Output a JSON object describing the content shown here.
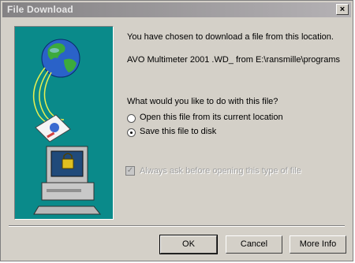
{
  "window": {
    "title": "File Download",
    "close_label": "×"
  },
  "message": {
    "intro": "You have chosen to download a file from this location.",
    "location": "AVO Multimeter 2001 .WD_ from E:\\ransmille\\programs"
  },
  "question": "What would you like to do with this file?",
  "options": [
    {
      "label": "Open this file from its current location",
      "selected": false
    },
    {
      "label": "Save this file to disk",
      "selected": true
    }
  ],
  "always_ask": {
    "label": "Always ask before opening this type of file",
    "checked": true,
    "disabled": true
  },
  "buttons": {
    "ok": "OK",
    "cancel": "Cancel",
    "more_info": "More Info"
  },
  "colors": {
    "art_bg": "#0a8a8a",
    "dialog_bg": "#d4d0c8",
    "title_bar": "#848284"
  }
}
